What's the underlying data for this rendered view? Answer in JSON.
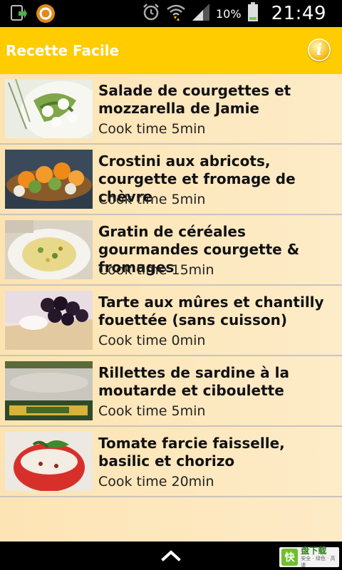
{
  "status_bar": {
    "battery_pct": "10%",
    "time": "21:49",
    "icons": [
      "download-icon",
      "app-icon",
      "alarm-icon",
      "wifi-icon",
      "signal-icon",
      "battery-icon"
    ]
  },
  "action_bar": {
    "title": "Recette Facile",
    "info_icon": "info-icon",
    "info_glyph": "i"
  },
  "recipes": [
    {
      "title": "Salade de courgettes et mozzarella de Jamie",
      "cook_label": "Cook time",
      "cook_time": "5min"
    },
    {
      "title": "Crostini aux abricots, courgette et fromage de chèvre",
      "cook_label": "Cook time",
      "cook_time": "5min"
    },
    {
      "title": " Gratin de céréales gourmandes courgette & fromages",
      "cook_label": "Cook time",
      "cook_time": "15min"
    },
    {
      "title": "Tarte aux mûres et chantilly fouettée (sans cuisson)",
      "cook_label": "Cook time",
      "cook_time": "0min"
    },
    {
      "title": "Rillettes de sardine à la moutarde et ciboulette",
      "cook_label": "Cook time",
      "cook_time": "5min"
    },
    {
      "title": "Tomate farcie faisselle, basilic et chorizo",
      "cook_label": "Cook time",
      "cook_time": "20min"
    }
  ],
  "nav_bar": {
    "up_icon": "chevron-up-icon",
    "badge_logo": "快",
    "badge_main": "盘下载",
    "badge_sub": "安全 · 绿色 · 高速"
  },
  "colors": {
    "action_bar": "#ffcc00",
    "list_bg": "#fde4b4",
    "divider": "#c9c4bc"
  }
}
